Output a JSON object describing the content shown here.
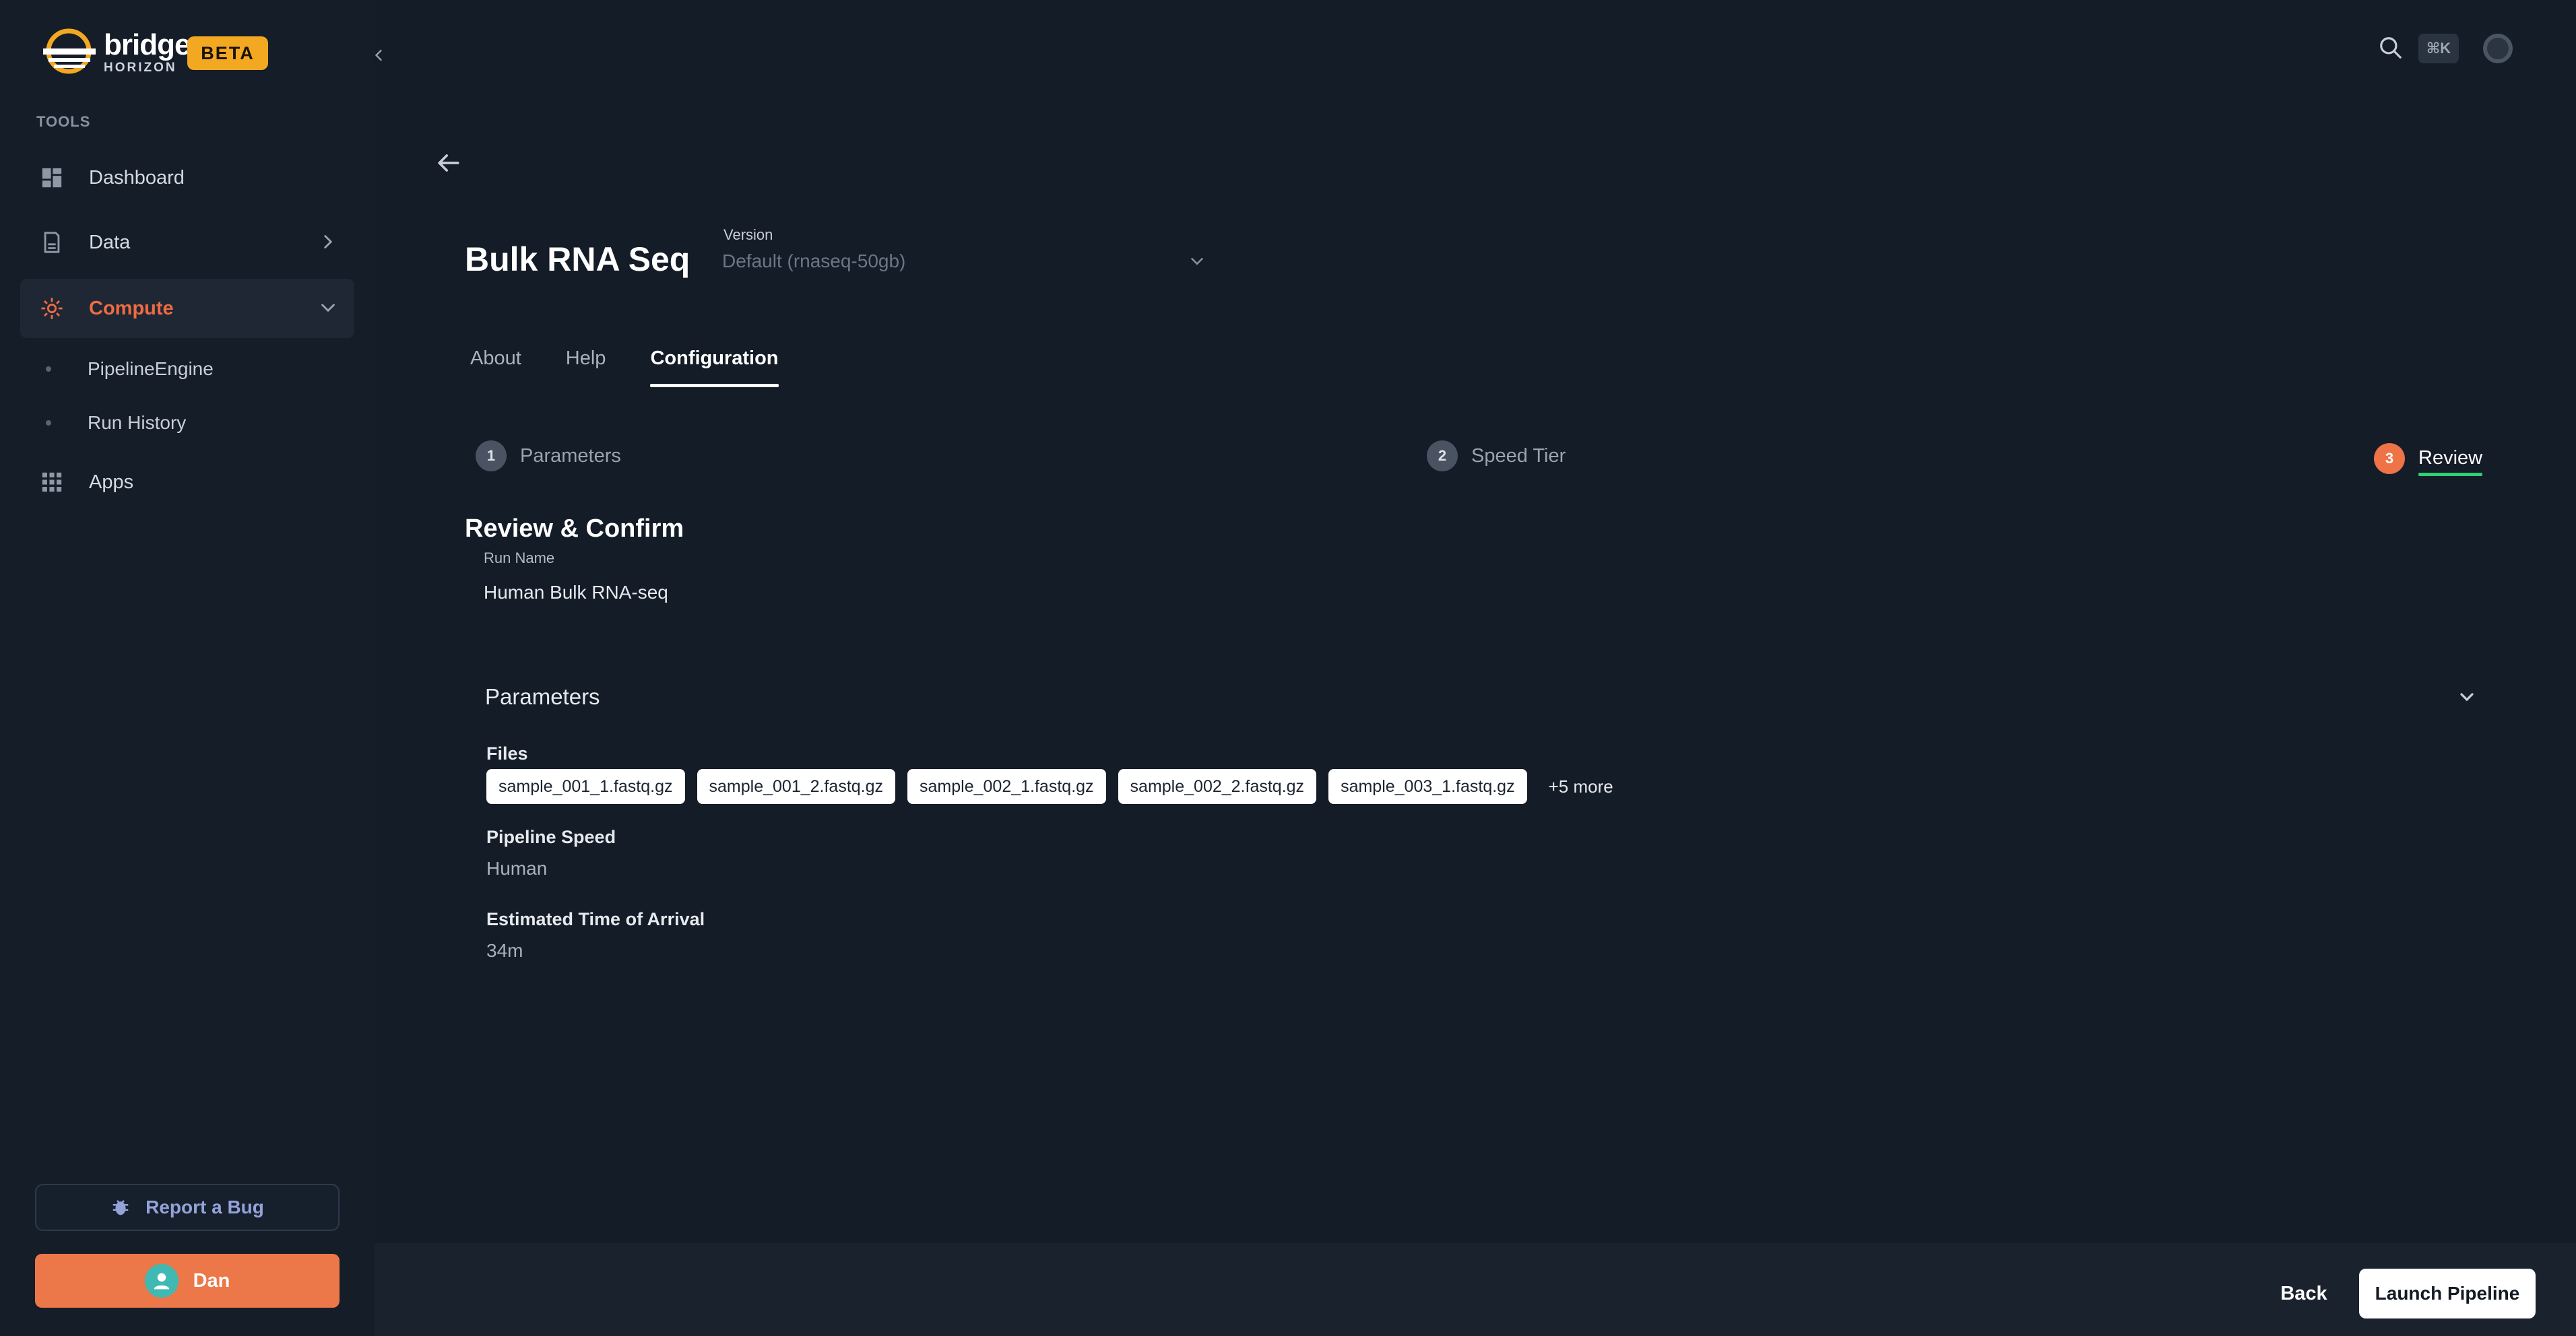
{
  "brand": {
    "name_line1": "bridge",
    "name_line2": "HORIZON",
    "badge": "BETA",
    "accent": "#ee7346",
    "badge_color": "#f2a821"
  },
  "sidebar": {
    "section_label": "TOOLS",
    "items": [
      {
        "label": "Dashboard",
        "icon": "dashboard-icon"
      },
      {
        "label": "Data",
        "icon": "database-icon"
      },
      {
        "label": "Compute",
        "icon": "gear-icon",
        "active": true
      },
      {
        "label": "Apps",
        "icon": "grid-icon"
      }
    ],
    "compute_subitems": [
      {
        "label": "PipelineEngine"
      },
      {
        "label": "Run History"
      }
    ],
    "report_bug": "Report a Bug",
    "user_name": "Dan"
  },
  "topbar": {
    "shortcut": "⌘K"
  },
  "pipeline": {
    "title": "Bulk RNA Seq",
    "version_label": "Version",
    "version_value": "Default (rnaseq-50gb)"
  },
  "tabs": [
    {
      "label": "About"
    },
    {
      "label": "Help"
    },
    {
      "label": "Configuration",
      "active": true
    }
  ],
  "steps": [
    {
      "num": "1",
      "label": "Parameters"
    },
    {
      "num": "2",
      "label": "Speed Tier"
    },
    {
      "num": "3",
      "label": "Review",
      "active": true
    }
  ],
  "review": {
    "title": "Review & Confirm",
    "run_name_label": "Run Name",
    "run_name_value": "Human Bulk RNA-seq",
    "parameters_title": "Parameters",
    "files_label": "Files",
    "files": [
      "sample_001_1.fastq.gz",
      "sample_001_2.fastq.gz",
      "sample_002_1.fastq.gz",
      "sample_002_2.fastq.gz",
      "sample_003_1.fastq.gz"
    ],
    "files_more": "+5 more",
    "speed_label": "Pipeline Speed",
    "speed_value": "Human",
    "eta_label": "Estimated Time of Arrival",
    "eta_value": "34m"
  },
  "footer": {
    "back": "Back",
    "launch": "Launch Pipeline"
  }
}
